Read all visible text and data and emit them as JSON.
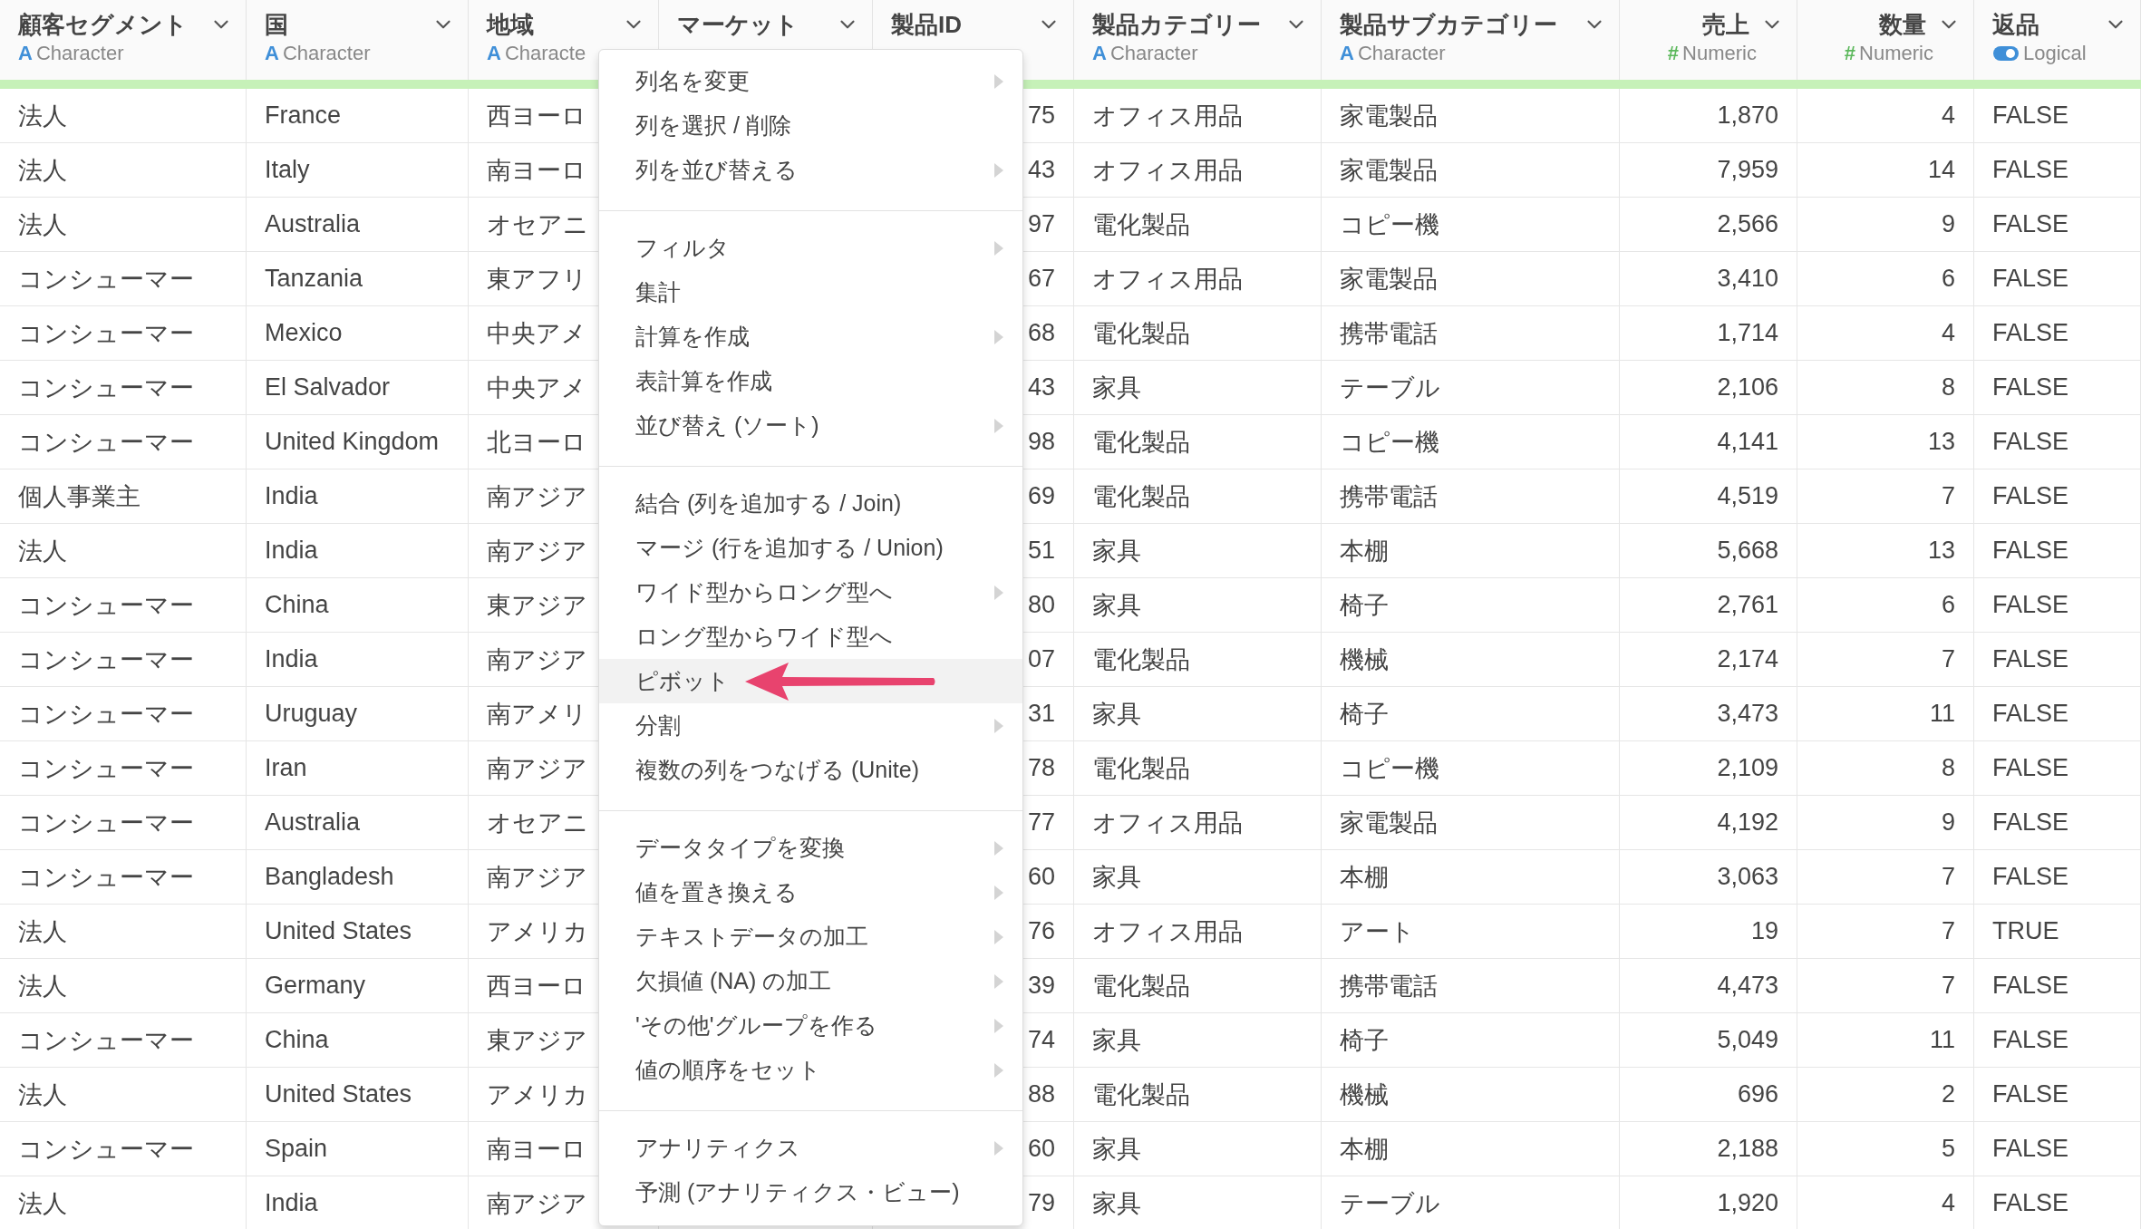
{
  "columns": [
    {
      "name": "顧客セグメント",
      "kind": "character",
      "icon": "A",
      "type_label": "Character"
    },
    {
      "name": "国",
      "kind": "character",
      "icon": "A",
      "type_label": "Character"
    },
    {
      "name": "地域",
      "kind": "character",
      "icon": "A",
      "type_label": "Characte"
    },
    {
      "name": "マーケット",
      "kind": "covered"
    },
    {
      "name": "製品ID",
      "kind": "covered"
    },
    {
      "name": "製品カテゴリー",
      "kind": "character",
      "icon": "A",
      "type_label": "Character"
    },
    {
      "name": "製品サブカテゴリー",
      "kind": "character",
      "icon": "A",
      "type_label": "Character"
    },
    {
      "name": "売上",
      "kind": "numeric",
      "icon": "#",
      "type_label": "Numeric"
    },
    {
      "name": "数量",
      "kind": "numeric",
      "icon": "#",
      "type_label": "Numeric"
    },
    {
      "name": "返品",
      "kind": "logical",
      "type_label": "Logical"
    }
  ],
  "rows": [
    [
      "法人",
      "France",
      "西ヨーロ",
      null,
      "75",
      "オフィス用品",
      "家電製品",
      "1,870",
      "4",
      "FALSE"
    ],
    [
      "法人",
      "Italy",
      "南ヨーロ",
      null,
      "43",
      "オフィス用品",
      "家電製品",
      "7,959",
      "14",
      "FALSE"
    ],
    [
      "法人",
      "Australia",
      "オセアニ",
      null,
      "97",
      "電化製品",
      "コピー機",
      "2,566",
      "9",
      "FALSE"
    ],
    [
      "コンシューマー",
      "Tanzania",
      "東アフリ",
      null,
      "67",
      "オフィス用品",
      "家電製品",
      "3,410",
      "6",
      "FALSE"
    ],
    [
      "コンシューマー",
      "Mexico",
      "中央アメ",
      null,
      "68",
      "電化製品",
      "携帯電話",
      "1,714",
      "4",
      "FALSE"
    ],
    [
      "コンシューマー",
      "El Salvador",
      "中央アメ",
      null,
      "43",
      "家具",
      "テーブル",
      "2,106",
      "8",
      "FALSE"
    ],
    [
      "コンシューマー",
      "United Kingdom",
      "北ヨーロ",
      null,
      "98",
      "電化製品",
      "コピー機",
      "4,141",
      "13",
      "FALSE"
    ],
    [
      "個人事業主",
      "India",
      "南アジア",
      null,
      "69",
      "電化製品",
      "携帯電話",
      "4,519",
      "7",
      "FALSE"
    ],
    [
      "法人",
      "India",
      "南アジア",
      null,
      "51",
      "家具",
      "本棚",
      "5,668",
      "13",
      "FALSE"
    ],
    [
      "コンシューマー",
      "China",
      "東アジア",
      null,
      "80",
      "家具",
      "椅子",
      "2,761",
      "6",
      "FALSE"
    ],
    [
      "コンシューマー",
      "India",
      "南アジア",
      null,
      "07",
      "電化製品",
      "機械",
      "2,174",
      "7",
      "FALSE"
    ],
    [
      "コンシューマー",
      "Uruguay",
      "南アメリ",
      null,
      "31",
      "家具",
      "椅子",
      "3,473",
      "11",
      "FALSE"
    ],
    [
      "コンシューマー",
      "Iran",
      "南アジア",
      null,
      "78",
      "電化製品",
      "コピー機",
      "2,109",
      "8",
      "FALSE"
    ],
    [
      "コンシューマー",
      "Australia",
      "オセアニ",
      null,
      "77",
      "オフィス用品",
      "家電製品",
      "4,192",
      "9",
      "FALSE"
    ],
    [
      "コンシューマー",
      "Bangladesh",
      "南アジア",
      null,
      "60",
      "家具",
      "本棚",
      "3,063",
      "7",
      "FALSE"
    ],
    [
      "法人",
      "United States",
      "アメリカ",
      null,
      "76",
      "オフィス用品",
      "アート",
      "19",
      "7",
      "TRUE"
    ],
    [
      "法人",
      "Germany",
      "西ヨーロ",
      null,
      "39",
      "電化製品",
      "携帯電話",
      "4,473",
      "7",
      "FALSE"
    ],
    [
      "コンシューマー",
      "China",
      "東アジア",
      null,
      "74",
      "家具",
      "椅子",
      "5,049",
      "11",
      "FALSE"
    ],
    [
      "法人",
      "United States",
      "アメリカ",
      null,
      "88",
      "電化製品",
      "機械",
      "696",
      "2",
      "FALSE"
    ],
    [
      "コンシューマー",
      "Spain",
      "南ヨーロ",
      null,
      "60",
      "家具",
      "本棚",
      "2,188",
      "5",
      "FALSE"
    ],
    [
      "法人",
      "India",
      "南アジア",
      null,
      "79",
      "家具",
      "テーブル",
      "1,920",
      "4",
      "FALSE"
    ]
  ],
  "menu": {
    "groups": [
      {
        "items": [
          {
            "label": "列名を変更",
            "submenu": true,
            "selected": false
          },
          {
            "label": "列を選択 / 削除",
            "submenu": false,
            "selected": false
          },
          {
            "label": "列を並び替える",
            "submenu": true,
            "selected": false
          }
        ]
      },
      {
        "items": [
          {
            "label": "フィルタ",
            "submenu": true,
            "selected": false
          },
          {
            "label": "集計",
            "submenu": false,
            "selected": false
          },
          {
            "label": "計算を作成",
            "submenu": true,
            "selected": false
          },
          {
            "label": "表計算を作成",
            "submenu": false,
            "selected": false
          },
          {
            "label": "並び替え (ソート)",
            "submenu": true,
            "selected": false
          }
        ]
      },
      {
        "items": [
          {
            "label": "結合 (列を追加する / Join)",
            "submenu": false,
            "selected": false
          },
          {
            "label": "マージ (行を追加する / Union)",
            "submenu": false,
            "selected": false
          },
          {
            "label": "ワイド型からロング型へ",
            "submenu": true,
            "selected": false
          },
          {
            "label": "ロング型からワイド型へ",
            "submenu": false,
            "selected": false
          },
          {
            "label": "ピボット",
            "submenu": false,
            "selected": true
          },
          {
            "label": "分割",
            "submenu": true,
            "selected": false
          },
          {
            "label": "複数の列をつなげる (Unite)",
            "submenu": false,
            "selected": false
          }
        ]
      },
      {
        "items": [
          {
            "label": "データタイプを変換",
            "submenu": true,
            "selected": false
          },
          {
            "label": "値を置き換える",
            "submenu": true,
            "selected": false
          },
          {
            "label": "テキストデータの加工",
            "submenu": true,
            "selected": false
          },
          {
            "label": "欠損値 (NA) の加工",
            "submenu": true,
            "selected": false
          },
          {
            "label": "'その他'グループを作る",
            "submenu": true,
            "selected": false
          },
          {
            "label": "値の順序をセット",
            "submenu": true,
            "selected": false
          }
        ]
      },
      {
        "items": [
          {
            "label": "アナリティクス",
            "submenu": true,
            "selected": false
          },
          {
            "label": "予測 (アナリティクス・ビュー)",
            "submenu": false,
            "selected": false
          }
        ]
      }
    ]
  }
}
